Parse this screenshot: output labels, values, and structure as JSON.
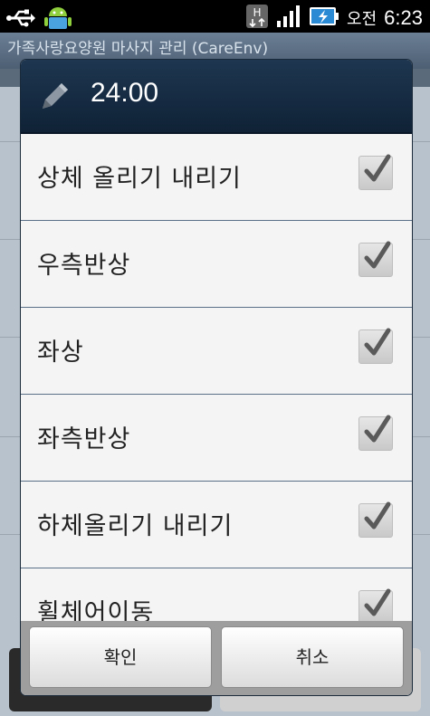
{
  "status_bar": {
    "ampm": "오전",
    "time": "6:23",
    "icons": [
      "usb-icon",
      "android-icon",
      "hspa-icon",
      "signal-icon",
      "battery-charging-icon"
    ]
  },
  "app": {
    "title": "가족사랑요양원 마사지 관리 (CareEnv)"
  },
  "dialog": {
    "title": "24:00",
    "icon": "pencil-icon",
    "items": [
      {
        "label": "상체 올리기 내리기",
        "checked": true
      },
      {
        "label": "우측반상",
        "checked": true
      },
      {
        "label": "좌상",
        "checked": true
      },
      {
        "label": "좌측반상",
        "checked": true
      },
      {
        "label": "하체올리기 내리기",
        "checked": true
      },
      {
        "label": "휠체어이동",
        "checked": true
      }
    ],
    "ok_label": "확인",
    "cancel_label": "취소"
  }
}
